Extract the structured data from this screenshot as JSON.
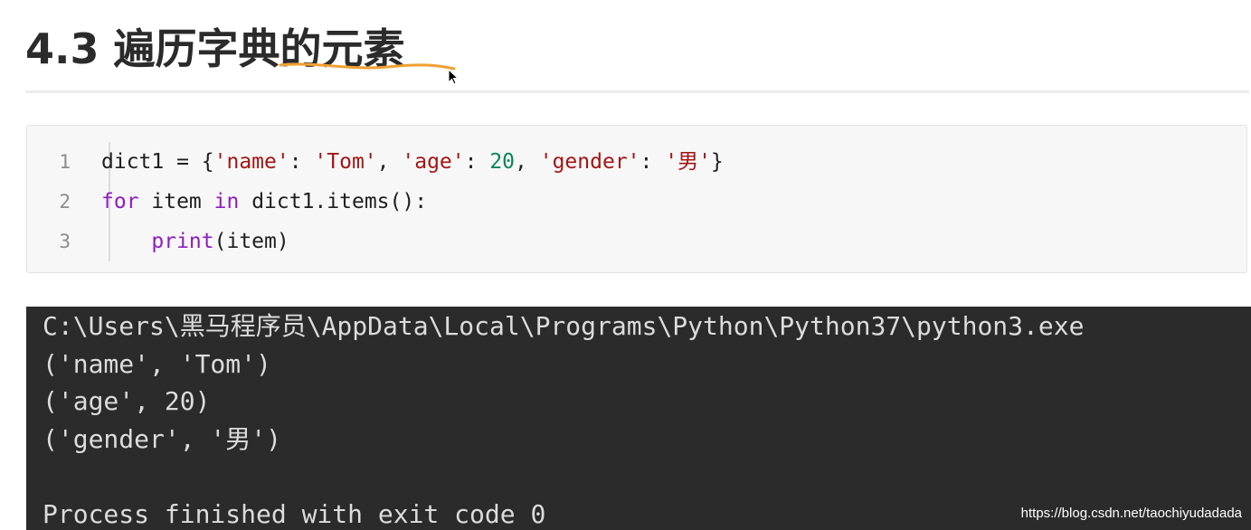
{
  "heading": {
    "title": "4.3 遍历字典的元素"
  },
  "code": {
    "lines": [
      {
        "number": "1",
        "tokens": [
          {
            "text": "dict1 = {",
            "type": "plain"
          },
          {
            "text": "'name'",
            "type": "str"
          },
          {
            "text": ": ",
            "type": "plain"
          },
          {
            "text": "'Tom'",
            "type": "str"
          },
          {
            "text": ", ",
            "type": "plain"
          },
          {
            "text": "'age'",
            "type": "str"
          },
          {
            "text": ": ",
            "type": "plain"
          },
          {
            "text": "20",
            "type": "num"
          },
          {
            "text": ", ",
            "type": "plain"
          },
          {
            "text": "'gender'",
            "type": "str"
          },
          {
            "text": ": ",
            "type": "plain"
          },
          {
            "text": "'男'",
            "type": "str"
          },
          {
            "text": "}",
            "type": "plain"
          }
        ]
      },
      {
        "number": "2",
        "tokens": [
          {
            "text": "for",
            "type": "kw"
          },
          {
            "text": " item ",
            "type": "plain"
          },
          {
            "text": "in",
            "type": "kw"
          },
          {
            "text": " dict1.items():",
            "type": "plain"
          }
        ]
      },
      {
        "number": "3",
        "tokens": [
          {
            "text": "    ",
            "type": "plain"
          },
          {
            "text": "print",
            "type": "kw"
          },
          {
            "text": "(item)",
            "type": "plain"
          }
        ]
      }
    ]
  },
  "console": {
    "lines": [
      "C:\\Users\\黑马程序员\\AppData\\Local\\Programs\\Python\\Python37\\python3.exe",
      "('name', 'Tom')",
      "('age', 20)",
      "('gender', '男')",
      "",
      "Process finished with exit code 0"
    ],
    "watermark": "https://blog.csdn.net/taochiyudadada"
  },
  "colors": {
    "string": "#a31515",
    "number": "#098658",
    "keyword": "#8d1ec1",
    "console_bg": "#2b2b2b",
    "highlight_underline": "#f0a030"
  }
}
